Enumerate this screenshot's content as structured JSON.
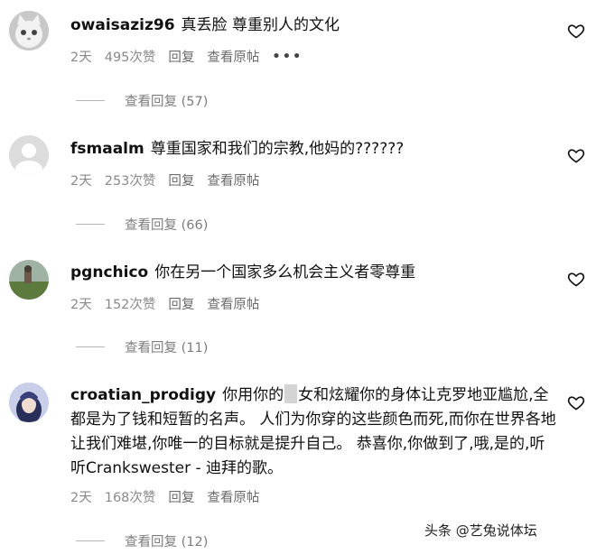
{
  "comments": [
    {
      "username": "owaisaziz96",
      "text": "真丢脸 尊重别人的文化",
      "time": "2天",
      "likes": "495次赞",
      "reply": "回复",
      "original": "查看原帖",
      "more": "•••",
      "view_replies": "查看回复 (57)",
      "avatar": "cat-avatar"
    },
    {
      "username": "fsmaalm",
      "text": "尊重国家和我们的宗教,他妈的??????",
      "time": "2天",
      "likes": "253次赞",
      "reply": "回复",
      "original": "查看原帖",
      "view_replies": "查看回复 (66)",
      "avatar": "default-avatar"
    },
    {
      "username": "pgnchico",
      "text": "你在另一个国家多么机会主义者零尊重",
      "time": "2天",
      "likes": "152次赞",
      "reply": "回复",
      "original": "查看原帖",
      "view_replies": "查看回复 (11)",
      "avatar": "landscape-avatar"
    },
    {
      "username": "croatian_prodigy",
      "text_a": "你用你的",
      "text_b": "女和炫耀你的身体让克罗地亚尴尬,全都是为了钱和短暂的名声。 人们为你穿的这些颜色而死,而你在世界各地让我们难堪,你唯一的目标就是提升自己。 恭喜你,你做到了,哦,是的,听听Crankswester - 迪拜的歌。",
      "time": "2天",
      "likes": "168次赞",
      "reply": "回复",
      "original": "查看原帖",
      "view_replies": "查看回复 (12)",
      "avatar": "anime-avatar"
    }
  ],
  "watermark": "头条 @艺兔说体坛",
  "icons": {
    "like": "heart-outline-icon"
  },
  "colors": {
    "text": "#111111",
    "meta": "#8a8a8a",
    "divider": "#b5b5b5"
  }
}
